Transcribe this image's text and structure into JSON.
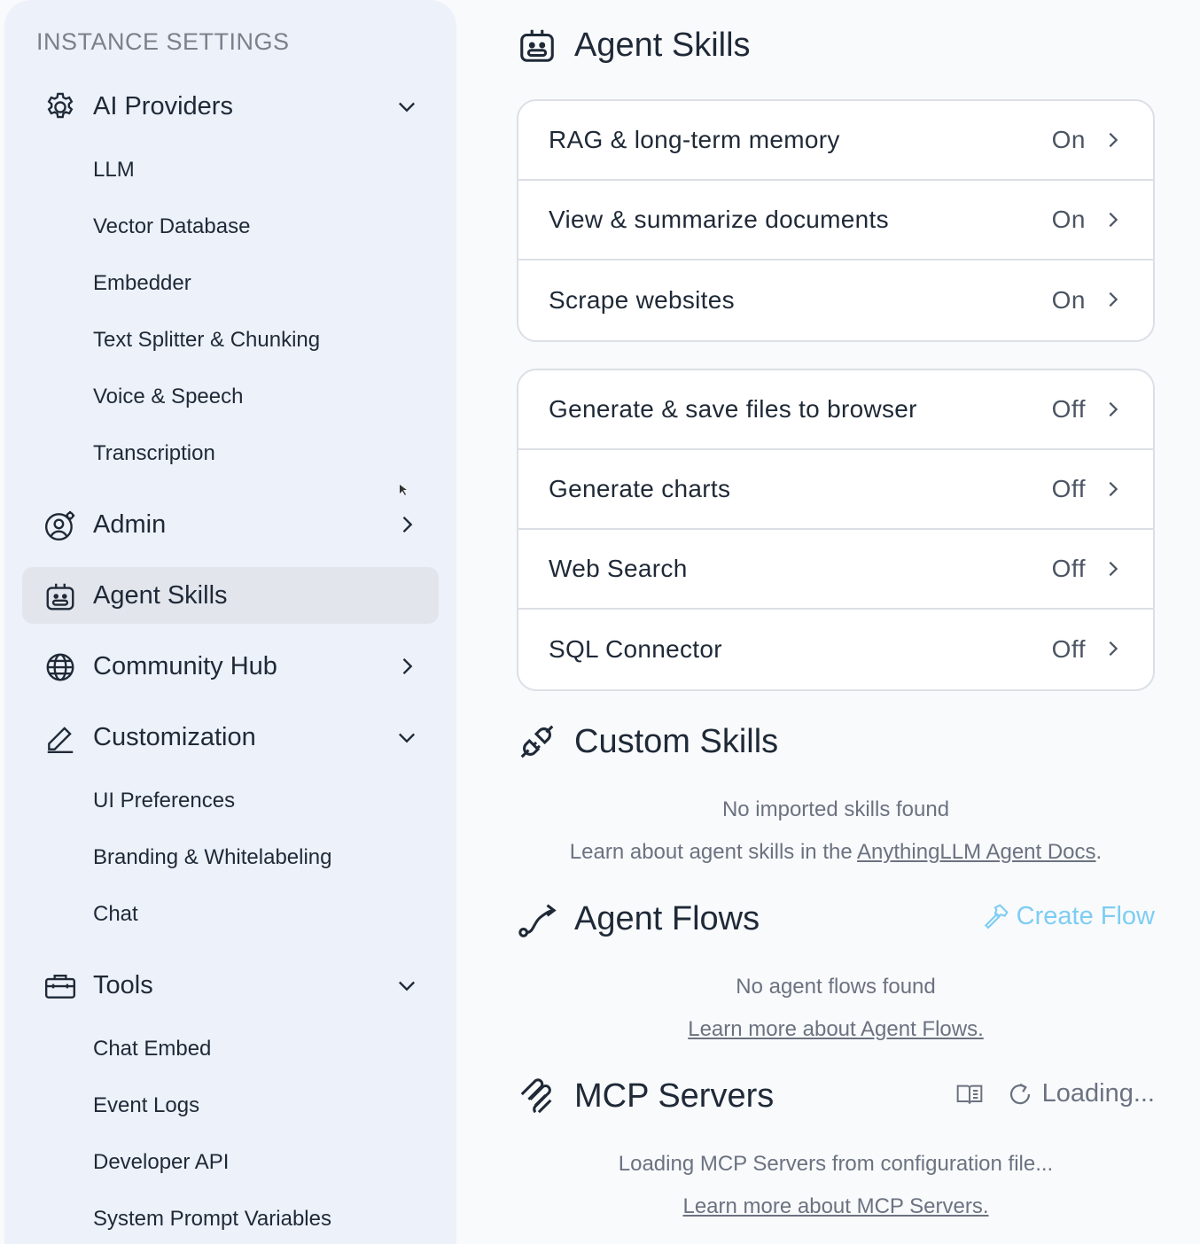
{
  "sidebar": {
    "heading": "INSTANCE SETTINGS",
    "groups": [
      {
        "label": "AI Providers",
        "icon": "gear-icon",
        "expanded": true,
        "items": [
          "LLM",
          "Vector Database",
          "Embedder",
          "Text Splitter & Chunking",
          "Voice & Speech",
          "Transcription"
        ]
      },
      {
        "label": "Admin",
        "icon": "user-gear-icon",
        "expanded": false
      },
      {
        "label": "Agent Skills",
        "icon": "robot-icon",
        "active": true
      },
      {
        "label": "Community Hub",
        "icon": "globe-icon",
        "expanded": false
      },
      {
        "label": "Customization",
        "icon": "pencil-icon",
        "expanded": true,
        "items": [
          "UI Preferences",
          "Branding & Whitelabeling",
          "Chat"
        ]
      },
      {
        "label": "Tools",
        "icon": "toolbox-icon",
        "expanded": true,
        "items": [
          "Chat Embed",
          "Event Logs",
          "Developer API",
          "System Prompt Variables"
        ]
      }
    ]
  },
  "main": {
    "agent_skills": {
      "title": "Agent Skills",
      "default_skills": [
        {
          "label": "RAG & long-term memory",
          "status": "On"
        },
        {
          "label": "View & summarize documents",
          "status": "On"
        },
        {
          "label": "Scrape websites",
          "status": "On"
        }
      ],
      "optional_skills": [
        {
          "label": "Generate & save files to browser",
          "status": "Off"
        },
        {
          "label": "Generate charts",
          "status": "Off"
        },
        {
          "label": "Web Search",
          "status": "Off"
        },
        {
          "label": "SQL Connector",
          "status": "Off"
        }
      ]
    },
    "custom_skills": {
      "title": "Custom Skills",
      "empty": "No imported skills found",
      "learn_prefix": "Learn about agent skills in the ",
      "learn_link": "AnythingLLM Agent Docs",
      "learn_suffix": "."
    },
    "agent_flows": {
      "title": "Agent Flows",
      "create_label": "Create Flow",
      "empty": "No agent flows found",
      "learn_link": "Learn more about Agent Flows."
    },
    "mcp_servers": {
      "title": "MCP Servers",
      "loading_label": "Loading...",
      "loading_message": "Loading MCP Servers from configuration file...",
      "learn_link": "Learn more about MCP Servers."
    }
  },
  "colors": {
    "accent": "#7dcdf3",
    "sidebar_bg": "#edf1f9",
    "active_bg": "#e2e5ec",
    "page_bg": "#f9fafc"
  }
}
